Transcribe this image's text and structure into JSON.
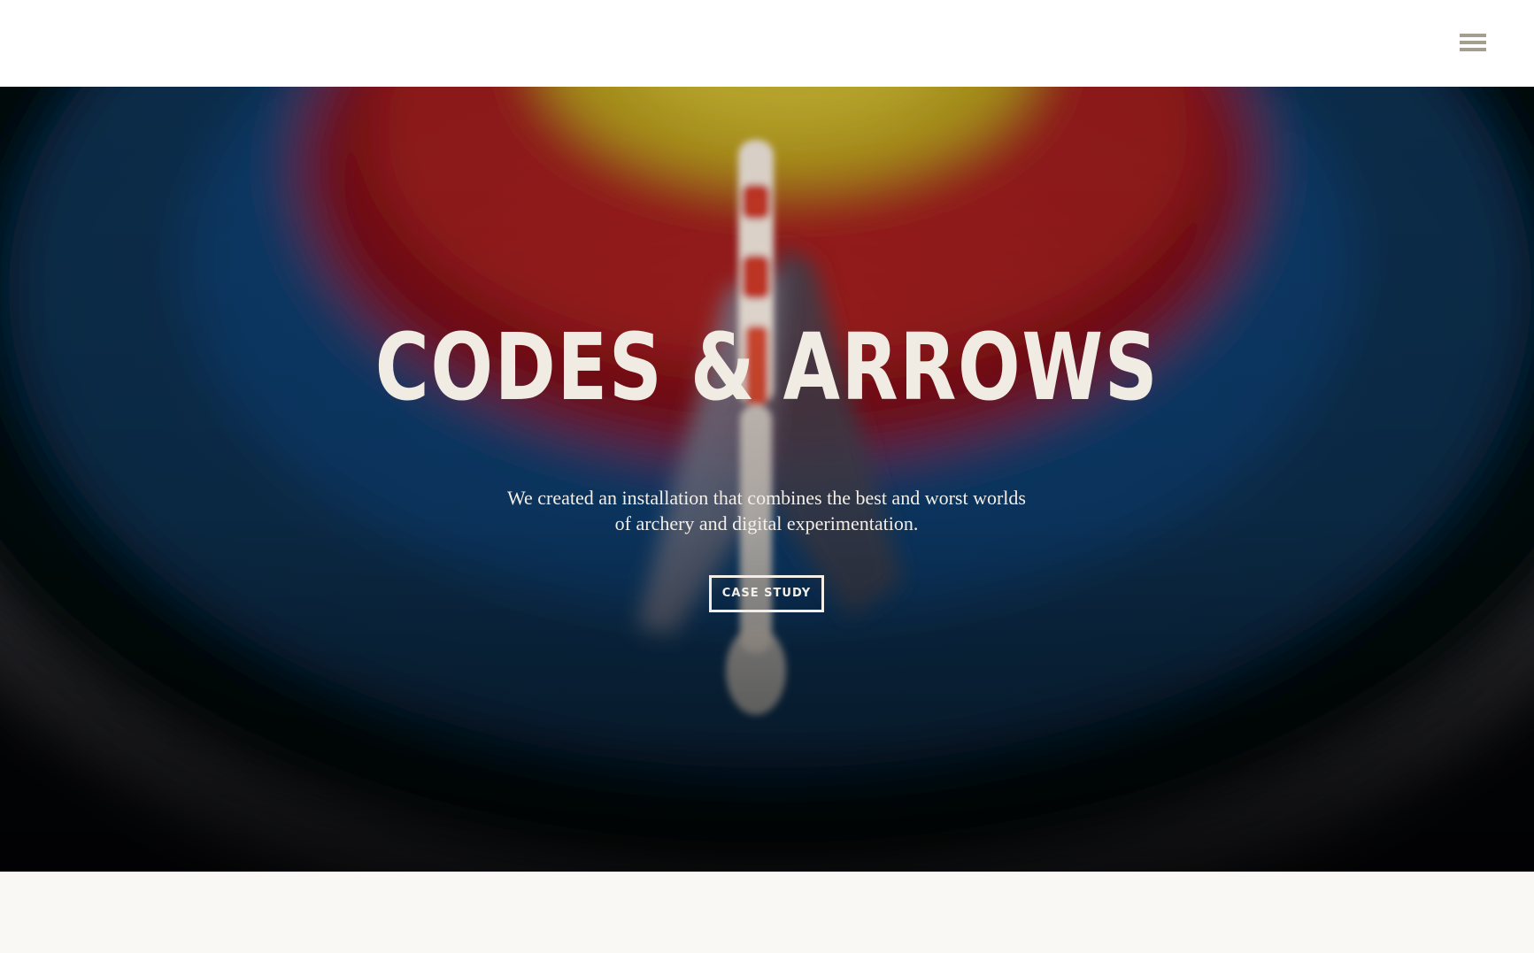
{
  "header": {
    "menu_icon": "hamburger-menu-icon",
    "menu_color": "#a69d91"
  },
  "hero": {
    "title": "CODES & ARROWS",
    "description": "We created an installation that combines the best and worst worlds of archery and digital experimentation.",
    "cta_label": "CASE STUDY",
    "text_color": "#f1ece3"
  },
  "footer_band": {
    "background": "#faf8f4"
  }
}
